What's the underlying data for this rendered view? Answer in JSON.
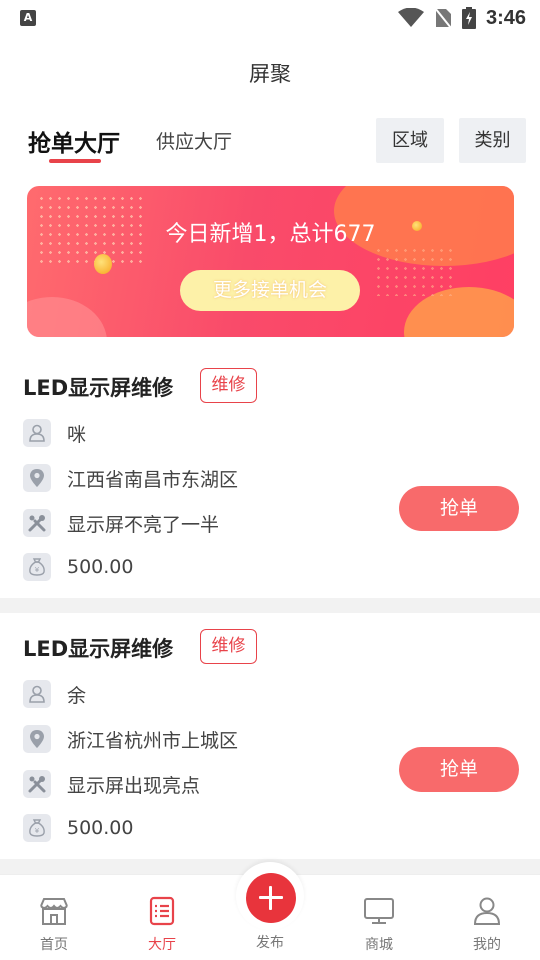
{
  "status_bar": {
    "time": "3:46",
    "notif_letter": "A"
  },
  "header": {
    "title": "屏聚"
  },
  "tabs": [
    {
      "label": "抢单大厅",
      "active": true
    },
    {
      "label": "供应大厅",
      "active": false
    }
  ],
  "filters": {
    "region": "区域",
    "category": "类别"
  },
  "banner": {
    "text": "今日新增1，总计677",
    "button": "更多接单机会"
  },
  "orders": [
    {
      "title": "LED显示屏维修",
      "tag": "维修",
      "contact": "咪",
      "address": "江西省南昌市东湖区",
      "issue": "显示屏不亮了一半",
      "price": "500.00",
      "action": "抢单"
    },
    {
      "title": "LED显示屏维修",
      "tag": "维修",
      "contact": "余",
      "address": "浙江省杭州市上城区",
      "issue": "显示屏出现亮点",
      "price": "500.00",
      "action": "抢单"
    }
  ],
  "nav": {
    "home": "首页",
    "hall": "大厅",
    "publish": "发布",
    "mall": "商城",
    "mine": "我的"
  },
  "colors": {
    "accent": "#e8434a",
    "grab_button": "#f86a6b",
    "icon_bg": "#e6e8ed"
  }
}
